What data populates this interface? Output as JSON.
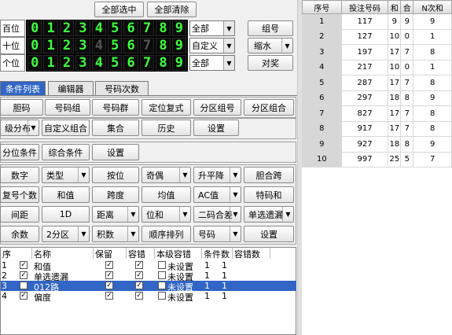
{
  "top_buttons": {
    "select_all": "全部选中",
    "clear_all": "全部清除"
  },
  "digits": [
    "0",
    "1",
    "2",
    "3",
    "4",
    "5",
    "6",
    "7",
    "8",
    "9"
  ],
  "rows": [
    {
      "label": "百位",
      "combo": "全部",
      "dim": []
    },
    {
      "label": "十位",
      "combo": "自定义",
      "dim": [
        4,
        7
      ]
    },
    {
      "label": "个位",
      "combo": "全部",
      "dim": []
    }
  ],
  "side_buttons": {
    "group": "组号",
    "shrink": "缩水",
    "prize": "对奖"
  },
  "tabs": [
    "条件列表",
    "编辑器",
    "号码次数"
  ],
  "g1": [
    "胆码",
    "号码组",
    "号码群",
    "定位复式",
    "分区组号",
    "分区组合"
  ],
  "g2": [
    "级分布",
    "自定义组合",
    "集合",
    "历史",
    "设置"
  ],
  "g3": [
    "分位条件",
    "综合条件",
    "设置"
  ],
  "g4": [
    [
      "数字",
      "类型",
      "按位",
      "奇偶",
      "升平降",
      "胆合跨"
    ],
    [
      "复号个数",
      "和值",
      "跨度",
      "均值",
      "AC值",
      "特码和"
    ],
    [
      "间距",
      "1D",
      "距离",
      "位和",
      "二码合差",
      "单选遗漏"
    ],
    [
      "余数",
      "2分区",
      "积数",
      "顺序排列",
      "号码",
      "设置"
    ]
  ],
  "list_headers": [
    "序",
    "名称",
    "保留",
    "容错",
    "本级容错",
    "条件数",
    "容错数"
  ],
  "list_rows": [
    {
      "no": "1",
      "name": "和值",
      "status": "未设置",
      "cnt": "1",
      "err": "1"
    },
    {
      "no": "2",
      "name": "单选遗漏",
      "status": "未设置",
      "cnt": "1",
      "err": "1"
    },
    {
      "no": "3",
      "name": "012路",
      "status": "未设置",
      "cnt": "1",
      "err": "1"
    },
    {
      "no": "4",
      "name": "偏度",
      "status": "未设置",
      "cnt": "1",
      "err": "1"
    }
  ],
  "table_headers": [
    "序号",
    "投注号码",
    "和",
    "合",
    "N次和"
  ],
  "table_rows": [
    [
      "1",
      "117",
      "9",
      "9",
      "9"
    ],
    [
      "2",
      "127",
      "10",
      "0",
      "1"
    ],
    [
      "3",
      "197",
      "17",
      "7",
      "8"
    ],
    [
      "4",
      "217",
      "10",
      "0",
      "1"
    ],
    [
      "5",
      "287",
      "17",
      "7",
      "8"
    ],
    [
      "6",
      "297",
      "18",
      "8",
      "9"
    ],
    [
      "7",
      "827",
      "17",
      "7",
      "8"
    ],
    [
      "8",
      "917",
      "17",
      "7",
      "8"
    ],
    [
      "9",
      "927",
      "18",
      "8",
      "9"
    ],
    [
      "10",
      "997",
      "25",
      "5",
      "7"
    ]
  ]
}
